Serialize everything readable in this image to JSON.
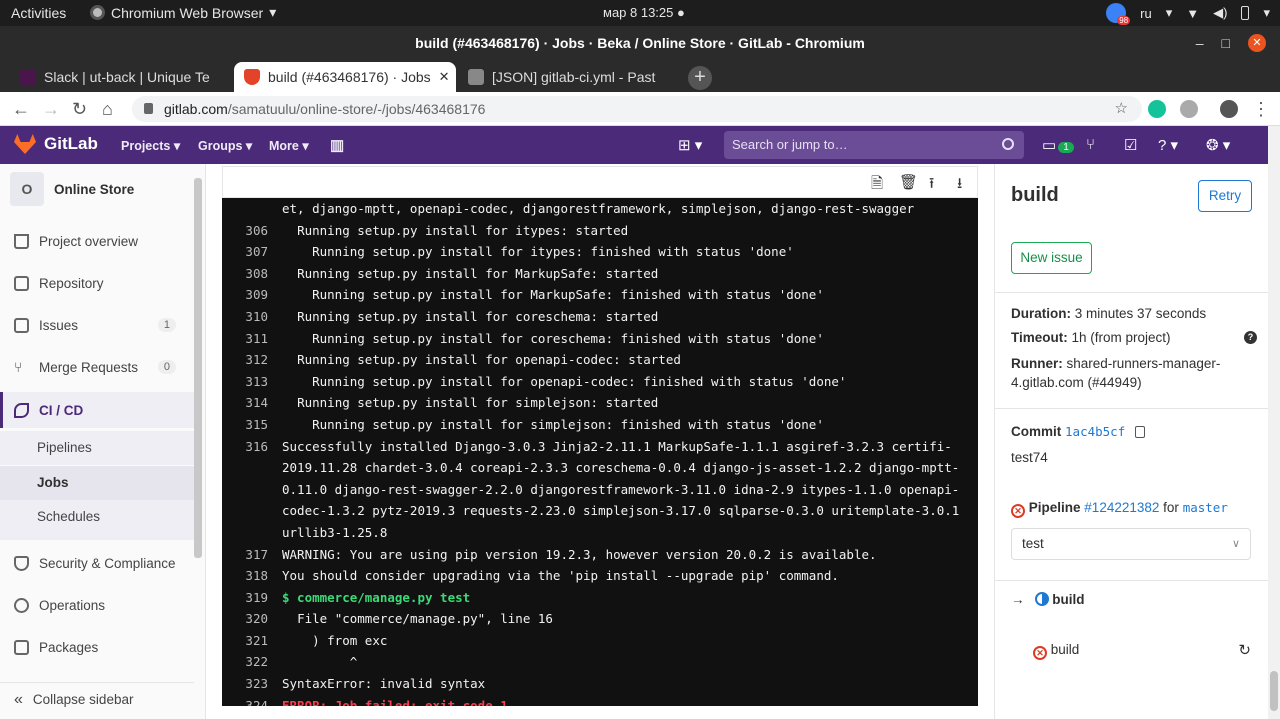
{
  "os": {
    "activities": "Activities",
    "app_name": "Chromium Web Browser",
    "clock": "мар 8  13:25",
    "lang": "ru",
    "badge": "98"
  },
  "window": {
    "title": "build (#463468176) · Jobs · Beka / Online Store · GitLab - Chromium"
  },
  "tabs": [
    {
      "label": "Slack | ut-back | Unique Te",
      "color": "#4a154b"
    },
    {
      "label": "build (#463468176) · Jobs",
      "color": "#e24329"
    },
    {
      "label": "[JSON] gitlab-ci.yml - Past",
      "color": "#888888"
    }
  ],
  "address": {
    "url_host": "gitlab.com",
    "url_path": "/samatuulu/online-store/-/jobs/463468176"
  },
  "header": {
    "brand": "GitLab",
    "nav": [
      "Projects",
      "Groups",
      "More"
    ],
    "search_placeholder": "Search or jump to…",
    "todo_count": "1"
  },
  "sidebar": {
    "project_initial": "O",
    "project_name": "Online Store",
    "items": [
      {
        "label": "Project overview"
      },
      {
        "label": "Repository"
      },
      {
        "label": "Issues",
        "count": "1"
      },
      {
        "label": "Merge Requests",
        "count": "0"
      },
      {
        "label": "CI / CD"
      }
    ],
    "subitems": [
      "Pipelines",
      "Jobs",
      "Schedules"
    ],
    "items2": [
      "Security & Compliance",
      "Operations",
      "Packages"
    ],
    "collapse": "Collapse sidebar"
  },
  "log": {
    "lines": [
      {
        "n": "",
        "t": "et, django-mptt, openapi-codec, djangorestframework, simplejson, django-rest-swagger",
        "c": ""
      },
      {
        "n": "306",
        "t": "  Running setup.py install for itypes: started",
        "c": ""
      },
      {
        "n": "307",
        "t": "    Running setup.py install for itypes: finished with status 'done'",
        "c": ""
      },
      {
        "n": "308",
        "t": "  Running setup.py install for MarkupSafe: started",
        "c": ""
      },
      {
        "n": "309",
        "t": "    Running setup.py install for MarkupSafe: finished with status 'done'",
        "c": ""
      },
      {
        "n": "310",
        "t": "  Running setup.py install for coreschema: started",
        "c": ""
      },
      {
        "n": "311",
        "t": "    Running setup.py install for coreschema: finished with status 'done'",
        "c": ""
      },
      {
        "n": "312",
        "t": "  Running setup.py install for openapi-codec: started",
        "c": ""
      },
      {
        "n": "313",
        "t": "    Running setup.py install for openapi-codec: finished with status 'done'",
        "c": ""
      },
      {
        "n": "314",
        "t": "  Running setup.py install for simplejson: started",
        "c": ""
      },
      {
        "n": "315",
        "t": "    Running setup.py install for simplejson: finished with status 'done'",
        "c": ""
      },
      {
        "n": "316",
        "t": "Successfully installed Django-3.0.3 Jinja2-2.11.1 MarkupSafe-1.1.1 asgiref-3.2.3 certifi-2019.11.28 chardet-3.0.4 coreapi-2.3.3 coreschema-0.0.4 django-js-asset-1.2.2 django-mptt-0.11.0 django-rest-swagger-2.2.0 djangorestframework-3.11.0 idna-2.9 itypes-1.1.0 openapi-codec-1.3.2 pytz-2019.3 requests-2.23.0 simplejson-3.17.0 sqlparse-0.3.0 uritemplate-3.0.1 urllib3-1.25.8",
        "c": ""
      },
      {
        "n": "317",
        "t": "WARNING: You are using pip version 19.2.3, however version 20.0.2 is available.",
        "c": ""
      },
      {
        "n": "318",
        "t": "You should consider upgrading via the 'pip install --upgrade pip' command.",
        "c": ""
      },
      {
        "n": "319",
        "t": "$ commerce/manage.py test",
        "c": "green"
      },
      {
        "n": "320",
        "t": "  File \"commerce/manage.py\", line 16",
        "c": ""
      },
      {
        "n": "321",
        "t": "    ) from exc",
        "c": ""
      },
      {
        "n": "322",
        "t": "         ^",
        "c": ""
      },
      {
        "n": "323",
        "t": "SyntaxError: invalid syntax",
        "c": ""
      },
      {
        "n": "324",
        "t": "ERROR: Job failed: exit code 1",
        "c": "red"
      }
    ]
  },
  "job": {
    "title": "build",
    "retry": "Retry",
    "new_issue": "New issue",
    "duration_label": "Duration:",
    "duration": "3 minutes 37 seconds",
    "timeout_label": "Timeout:",
    "timeout": "1h (from project)",
    "runner_label": "Runner:",
    "runner": "shared-runners-manager-4.gitlab.com (#44949)",
    "commit_label": "Commit",
    "commit_sha": "1ac4b5cf",
    "commit_msg": "test74",
    "pipeline_label": "Pipeline",
    "pipeline_id": "#124221382",
    "pipeline_for": "for",
    "branch": "master",
    "stage_select": "test",
    "stage_name": "build",
    "job_name": "build"
  }
}
